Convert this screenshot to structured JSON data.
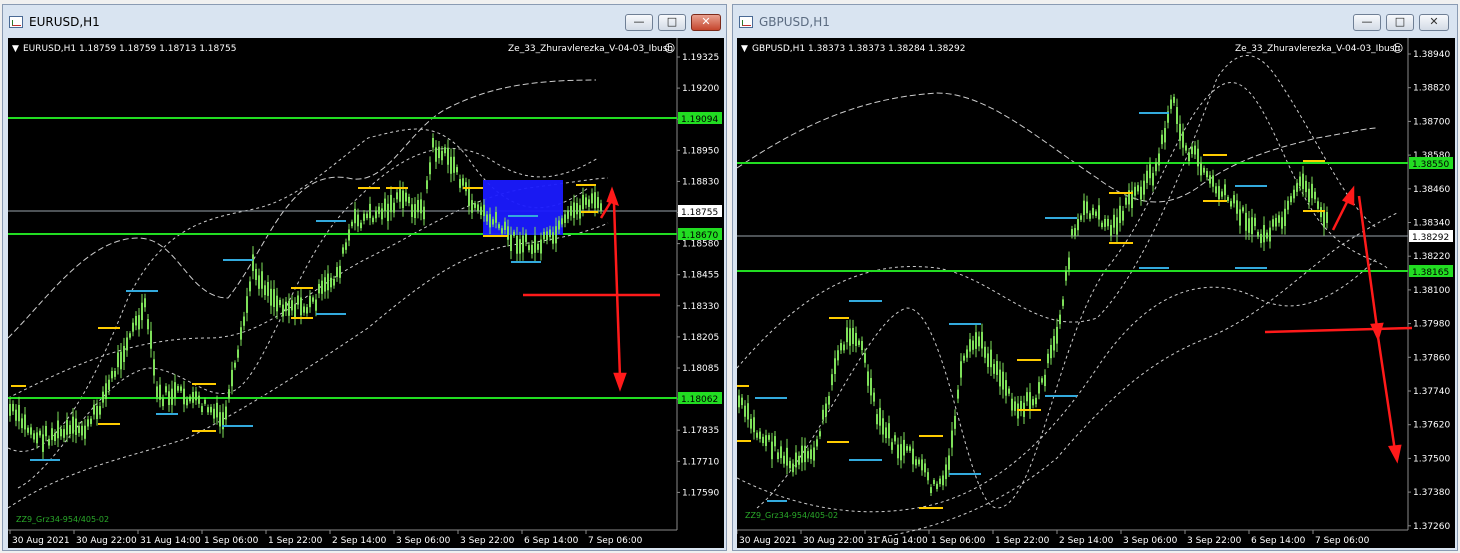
{
  "windows": [
    {
      "title": "EURUSD,H1",
      "header": "EURUSD,H1  1.18759 1.18759 1.18713 1.18755",
      "indicator": "Ze_33_Zhuravlerezka_V-04-03_Ibush",
      "bottom_label": "ZZ9_Grz34-954/405-02",
      "price_ticks": [
        "1.19325",
        "1.19200",
        "1.19075",
        "1.18950",
        "1.18830",
        "1.18705",
        "1.18580",
        "1.18455",
        "1.18330",
        "1.18205",
        "1.18085",
        "1.17960",
        "1.17835",
        "1.17710",
        "1.17590"
      ],
      "time_ticks": [
        "30 Aug 2021",
        "30 Aug 22:00",
        "31 Aug 14:00",
        "1 Sep 06:00",
        "1 Sep 22:00",
        "2 Sep 14:00",
        "3 Sep 06:00",
        "3 Sep 22:00",
        "6 Sep 14:00",
        "7 Sep 06:00"
      ],
      "level_badges": [
        "1.19094",
        "1.18670",
        "1.18062"
      ],
      "current_price": "1.18755",
      "colors": {
        "level": "#22dd22",
        "candle": "#7ee05a",
        "arrow": "#ff1a1a",
        "box": "#1a1aff"
      }
    },
    {
      "title": "GBPUSD,H1",
      "header": "GBPUSD,H1  1.38373 1.38373 1.38284 1.38292",
      "indicator": "Ze_33_Zhuravlerezka_V-04-03_Ibush",
      "bottom_label": "ZZ9_Grz34-954/405-02",
      "price_ticks": [
        "1.38940",
        "1.38820",
        "1.38700",
        "1.38580",
        "1.38460",
        "1.38340",
        "1.38220",
        "1.38100",
        "1.37980",
        "1.37860",
        "1.37740",
        "1.37620",
        "1.37500",
        "1.37380",
        "1.37260"
      ],
      "time_ticks": [
        "30 Aug 2021",
        "30 Aug 22:00",
        "31 Aug 14:00",
        "1 Sep 06:00",
        "1 Sep 22:00",
        "2 Sep 14:00",
        "3 Sep 06:00",
        "3 Sep 22:00",
        "6 Sep 14:00",
        "7 Sep 06:00"
      ],
      "level_badges": [
        "1.38550",
        "1.38165"
      ],
      "current_price": "1.38292",
      "colors": {
        "level": "#22dd22",
        "candle": "#7ee05a",
        "arrow": "#ff1a1a"
      }
    }
  ]
}
